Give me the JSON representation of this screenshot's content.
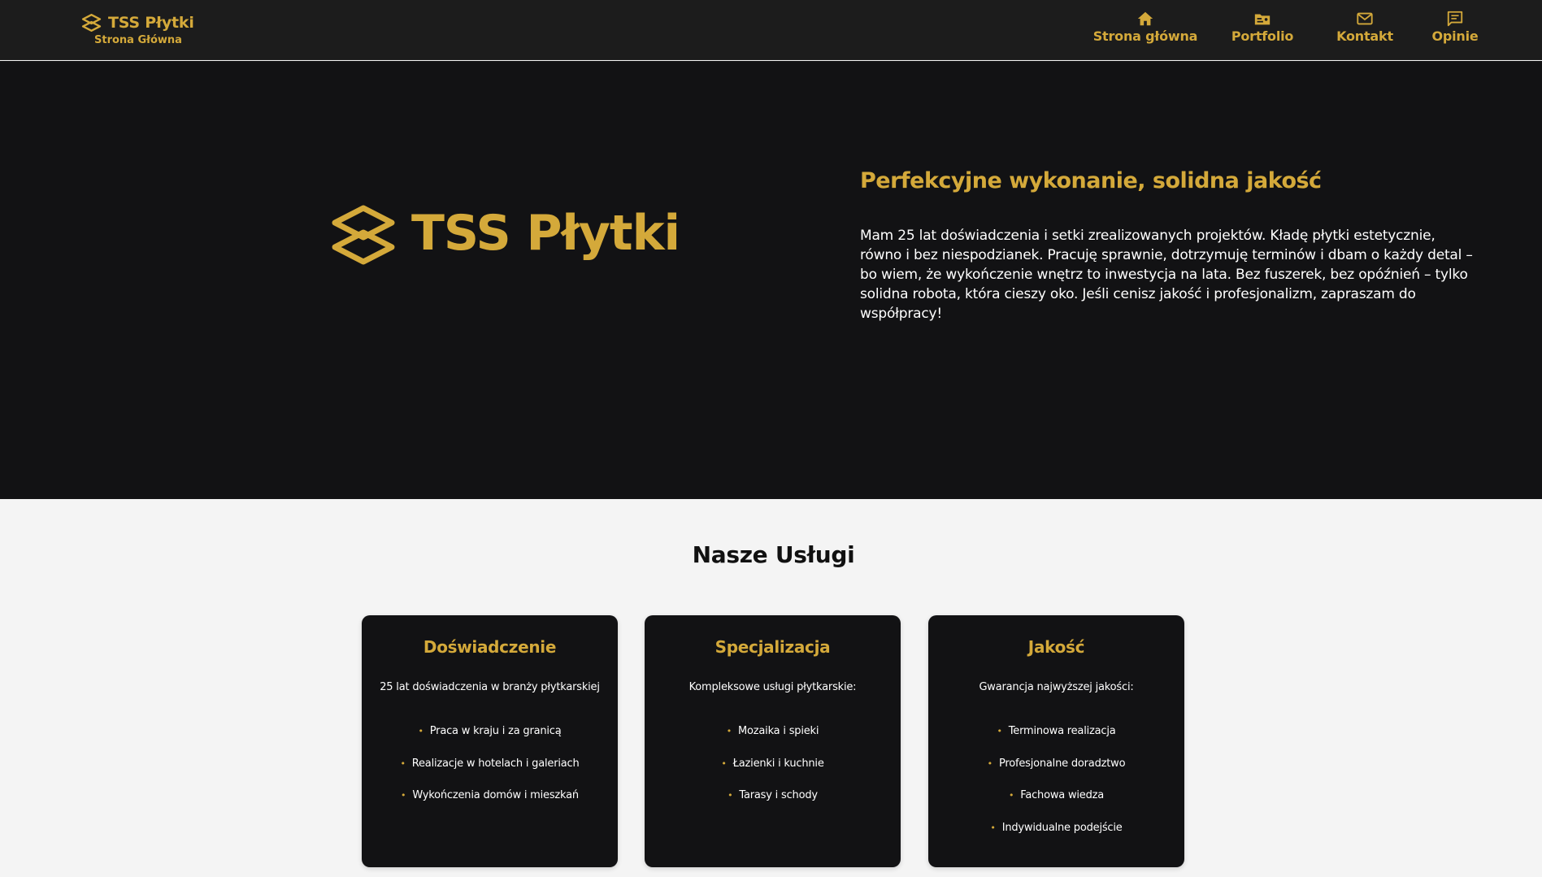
{
  "colors": {
    "accent": "#d4a93a",
    "header_bg": "#1c1c1c",
    "hero_bg": "#121214",
    "page_bg": "#f4f4f4",
    "card_bg": "#121214"
  },
  "header": {
    "brand_name": "TSS Płytki",
    "brand_subtitle": "Strona Główna",
    "brand_icon": "tiles-logo-icon",
    "nav": [
      {
        "label": "Strona główna",
        "icon": "home-icon"
      },
      {
        "label": "Portfolio",
        "icon": "portfolio-icon"
      },
      {
        "label": "Kontakt",
        "icon": "mail-icon"
      },
      {
        "label": "Opinie",
        "icon": "reviews-icon"
      }
    ]
  },
  "hero": {
    "logo_text": "TSS Płytki",
    "logo_icon": "tiles-logo-icon",
    "title": "Perfekcyjne wykonanie, solidna jakość",
    "text": "Mam 25 lat doświadczenia i setki zrealizowanych projektów. Kładę płytki estetycznie, równo i bez niespodzianek. Pracuję sprawnie, dotrzymuję terminów i dbam o każdy detal – bo wiem, że wykończenie wnętrz to inwestycja na lata. Bez fuszerek, bez opóźnień – tylko solidna robota, która cieszy oko. Jeśli cenisz jakość i profesjonalizm, zapraszam do współpracy!"
  },
  "services": {
    "title": "Nasze Usługi",
    "cards": [
      {
        "title": "Doświadczenie",
        "subtitle": "25 lat doświadczenia w branży płytkarskiej",
        "items": [
          "Praca w kraju i za granicą",
          "Realizacje w hotelach i galeriach",
          "Wykończenia domów i mieszkań"
        ]
      },
      {
        "title": "Specjalizacja",
        "subtitle": "Kompleksowe usługi płytkarskie:",
        "items": [
          "Mozaika i spieki",
          "Łazienki i kuchnie",
          "Tarasy i schody"
        ]
      },
      {
        "title": "Jakość",
        "subtitle": "Gwarancja najwyższej jakości:",
        "items": [
          "Terminowa realizacja",
          "Profesjonalne doradztwo",
          "Fachowa wiedza",
          "Indywidualne podejście"
        ]
      }
    ]
  }
}
